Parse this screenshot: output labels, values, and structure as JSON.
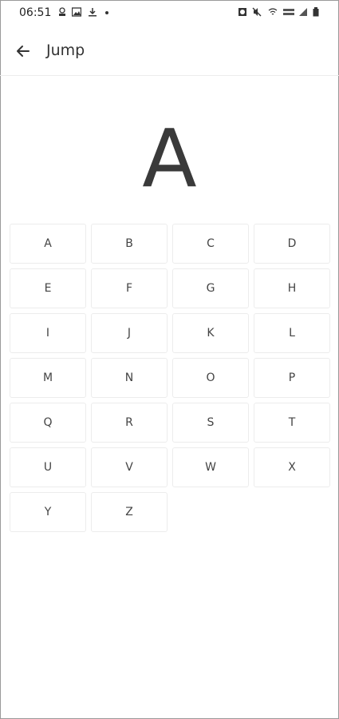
{
  "status_bar": {
    "time": "06:51",
    "icons": [
      "notification-icon",
      "image-icon",
      "download-icon",
      "dot-icon",
      "alarm-icon",
      "mute-icon",
      "wifi-icon",
      "volte-icon",
      "signal-icon",
      "battery-icon"
    ]
  },
  "app_bar": {
    "title": "Jump",
    "back_icon": "back-arrow-icon"
  },
  "selected_letter": "A",
  "letters": [
    "A",
    "B",
    "C",
    "D",
    "E",
    "F",
    "G",
    "H",
    "I",
    "J",
    "K",
    "L",
    "M",
    "N",
    "O",
    "P",
    "Q",
    "R",
    "S",
    "T",
    "U",
    "V",
    "W",
    "X",
    "Y",
    "Z"
  ]
}
